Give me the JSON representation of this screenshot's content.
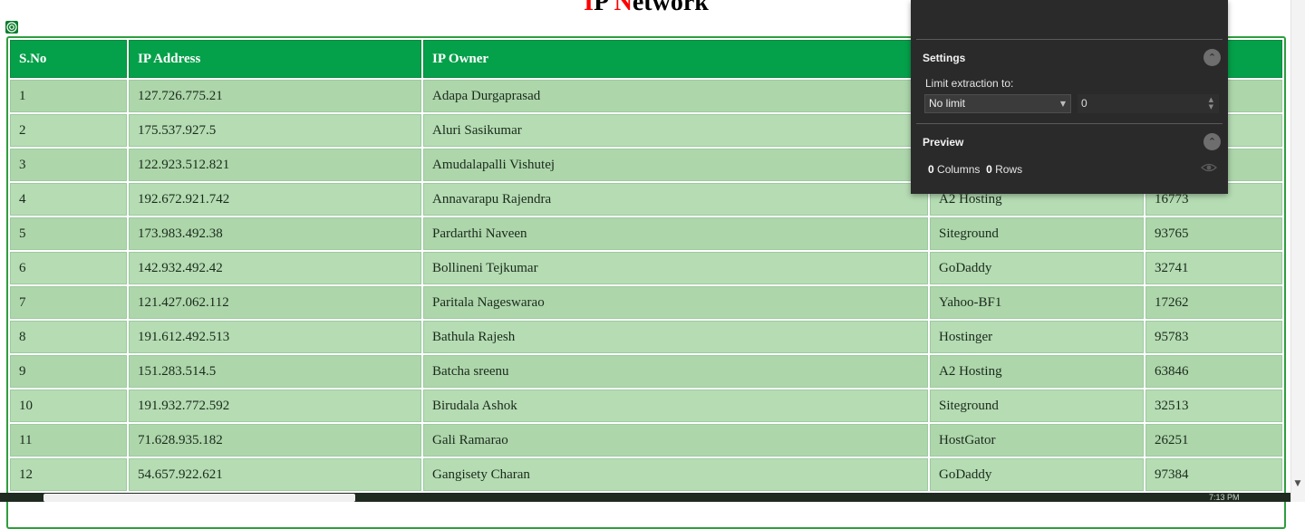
{
  "page": {
    "title_first_a": "I",
    "title_rest_a": "P ",
    "title_first_b": "N",
    "title_rest_b": "etwork"
  },
  "table": {
    "headers": [
      "S.No",
      "IP Address",
      "IP Owner",
      "",
      ""
    ],
    "rows": [
      [
        "1",
        "127.726.775.21",
        "Adapa Durgaprasad",
        "",
        ""
      ],
      [
        "2",
        "175.537.927.5",
        "Aluri Sasikumar",
        "",
        ""
      ],
      [
        "3",
        "122.923.512.821",
        "Amudalapalli Vishutej",
        "",
        ""
      ],
      [
        "4",
        "192.672.921.742",
        "Annavarapu Rajendra",
        "A2 Hosting",
        "16773"
      ],
      [
        "5",
        "173.983.492.38",
        "Pardarthi Naveen",
        "Siteground",
        "93765"
      ],
      [
        "6",
        "142.932.492.42",
        "Bollineni Tejkumar",
        "GoDaddy",
        "32741"
      ],
      [
        "7",
        "121.427.062.112",
        "Paritala Nageswarao",
        "Yahoo-BF1",
        "17262"
      ],
      [
        "8",
        "191.612.492.513",
        "Bathula Rajesh",
        "Hostinger",
        "95783"
      ],
      [
        "9",
        "151.283.514.5",
        "Batcha sreenu",
        "A2 Hosting",
        "63846"
      ],
      [
        "10",
        "191.932.772.592",
        "Birudala Ashok",
        "Siteground",
        "32513"
      ],
      [
        "11",
        "71.628.935.182",
        "Gali Ramarao",
        "HostGator",
        "26251"
      ],
      [
        "12",
        "54.657.922.621",
        "Gangisety Charan",
        "GoDaddy",
        "97384"
      ]
    ]
  },
  "extension_panel": {
    "settings_title": "Settings",
    "limit_label": "Limit extraction to:",
    "limit_value": "No limit",
    "limit_number": "0",
    "preview_title": "Preview",
    "columns_count": "0",
    "columns_label": "Columns",
    "rows_count": "0",
    "rows_label": "Rows"
  },
  "taskbar": {
    "clock": "7:13 PM"
  },
  "colors": {
    "header_green": "#05a04a",
    "row_green": "#add6ab",
    "title_red": "#ff0000",
    "panel_dark": "#2a2a2a"
  },
  "icons": [
    "select-target-icon",
    "chevron-up-icon",
    "eye-icon",
    "dropdown-caret-icon"
  ]
}
